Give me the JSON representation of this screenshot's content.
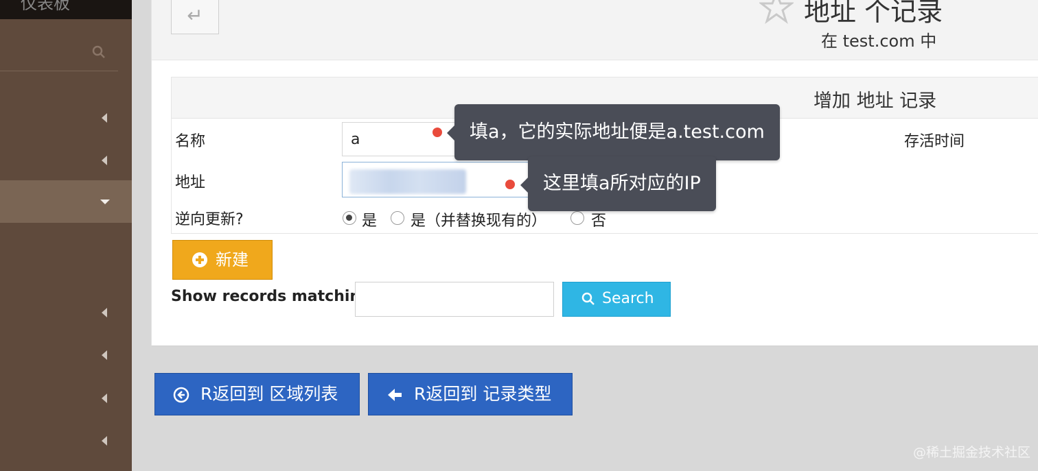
{
  "sidebar": {
    "top_label": "仪表板",
    "search_icon": "search-icon"
  },
  "header": {
    "back_icon": "return-arrow-icon",
    "title": "地址 个记录",
    "subtitle": "在 test.com 中"
  },
  "form": {
    "heading": "增加 地址 记录",
    "name_label": "名称",
    "name_value": "a",
    "address_label": "地址",
    "ttl_label": "存活时间",
    "reverse_label": "逆向更新?",
    "reverse_options": [
      {
        "label": "是",
        "selected": true
      },
      {
        "label": "是（并替换现有的）",
        "selected": false
      },
      {
        "label": "否",
        "selected": false
      }
    ]
  },
  "tooltips": {
    "name_tip": "填a，它的实际地址便是a.test.com",
    "address_tip": "这里填a所对应的IP"
  },
  "actions": {
    "new_label": "新建",
    "search_label": "Show records matching:",
    "search_value": "",
    "search_button": "Search",
    "back_zone_list": "R返回到 区域列表",
    "back_record_type": "R返回到 记录类型"
  },
  "colors": {
    "sidebar": "#5f4a3c",
    "new_button": "#f0a81c",
    "search_button": "#2fb6e4",
    "back_buttons": "#2d65c2",
    "tooltip": "#4a4d57",
    "marker": "#e94b3c"
  },
  "watermark": "@稀土掘金技术社区"
}
